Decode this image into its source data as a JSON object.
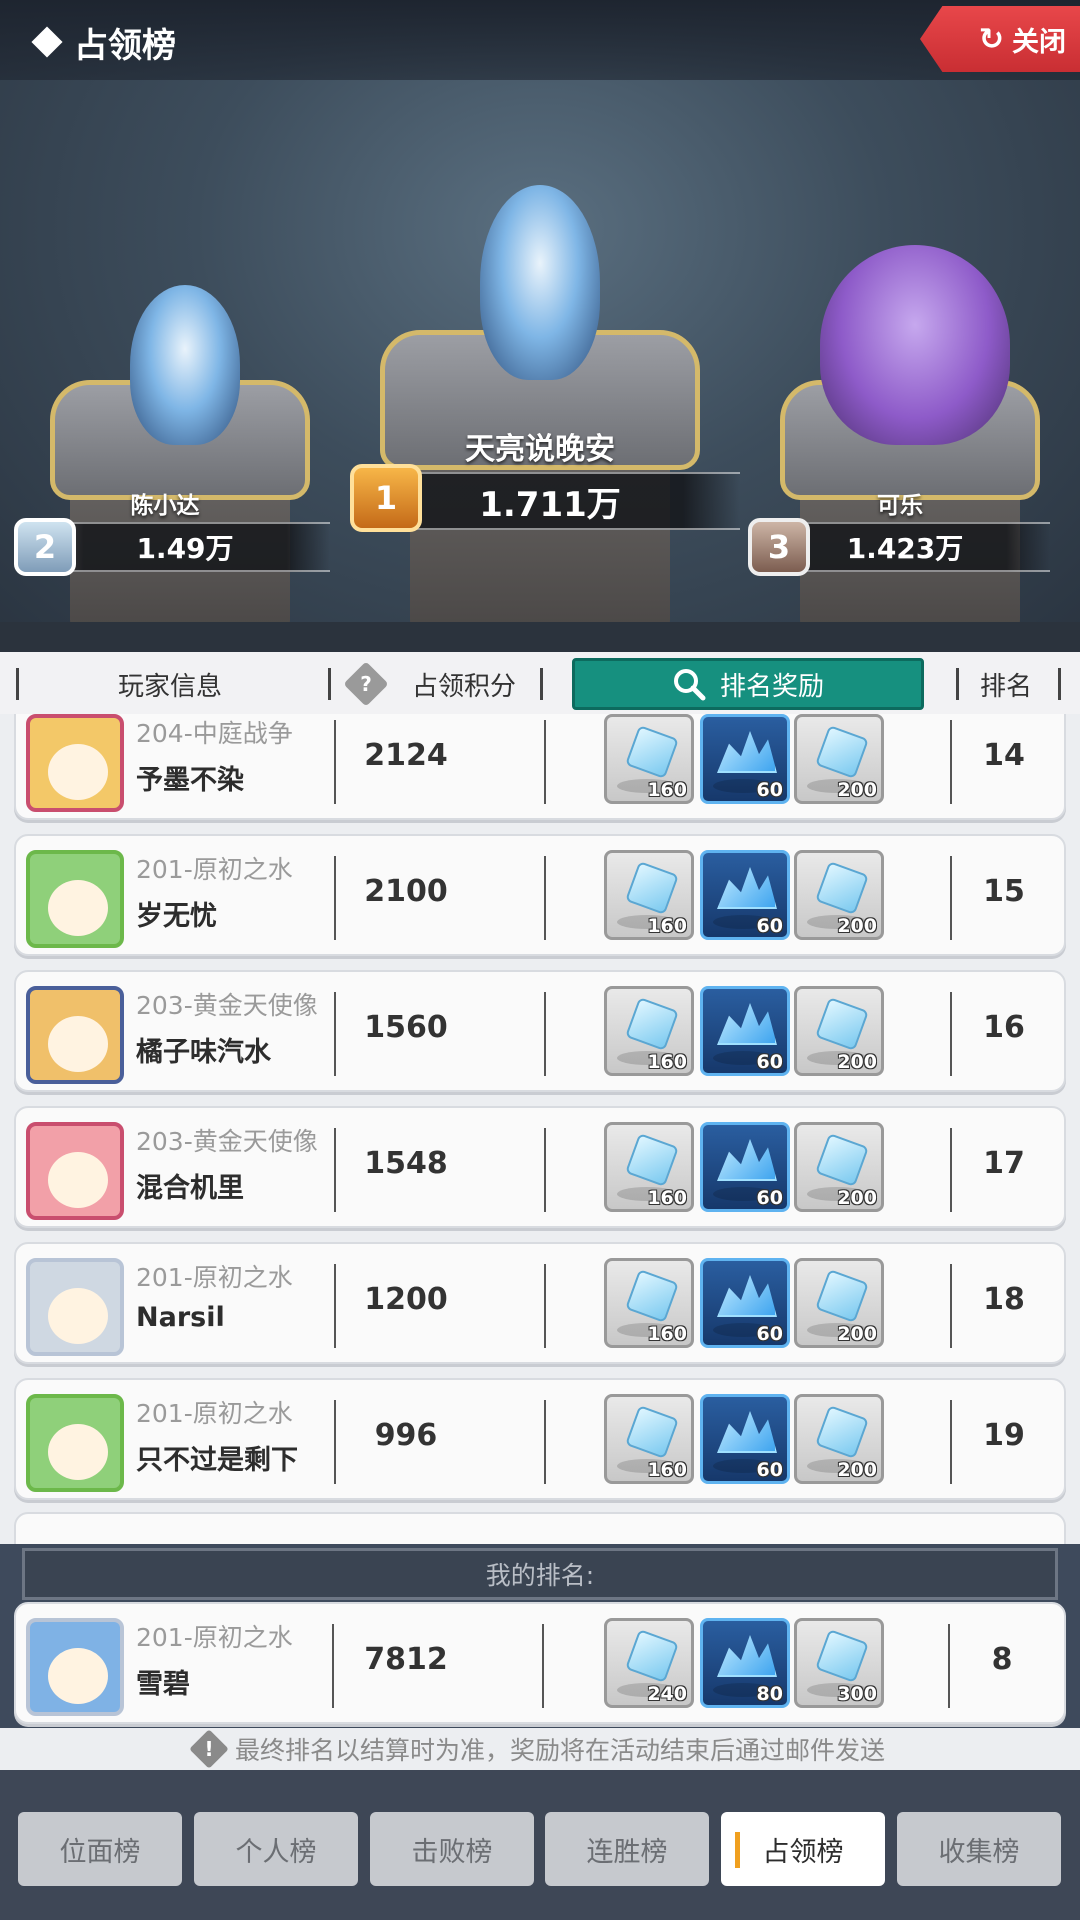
{
  "header": {
    "title": "占领榜",
    "close_label": "关闭"
  },
  "podium": {
    "first": {
      "name": "天亮说晚安",
      "score": "1.711万",
      "rank": "1"
    },
    "second": {
      "name": "陈小达",
      "score": "1.49万",
      "rank": "2"
    },
    "third": {
      "name": "可乐",
      "score": "1.423万",
      "rank": "3"
    }
  },
  "columns": {
    "player_info": "玩家信息",
    "score": "占领积分",
    "rewards": "排名奖励",
    "rank": "排名"
  },
  "rows": [
    {
      "server": "204-中庭战争",
      "name": "予墨不染",
      "score": "2124",
      "rewards": [
        "160",
        "60",
        "200"
      ],
      "rank": "14"
    },
    {
      "server": "201-原初之水",
      "name": "岁无忧",
      "score": "2100",
      "rewards": [
        "160",
        "60",
        "200"
      ],
      "rank": "15"
    },
    {
      "server": "203-黄金天使像",
      "name": "橘子味汽水",
      "score": "1560",
      "rewards": [
        "160",
        "60",
        "200"
      ],
      "rank": "16"
    },
    {
      "server": "203-黄金天使像",
      "name": "混合机里",
      "score": "1548",
      "rewards": [
        "160",
        "60",
        "200"
      ],
      "rank": "17"
    },
    {
      "server": "201-原初之水",
      "name": "Narsil",
      "score": "1200",
      "rewards": [
        "160",
        "60",
        "200"
      ],
      "rank": "18"
    },
    {
      "server": "201-原初之水",
      "name": "只不过是剩下",
      "score": "996",
      "rewards": [
        "160",
        "60",
        "200"
      ],
      "rank": "19"
    }
  ],
  "my_rank": {
    "label": "我的排名:",
    "server": "201-原初之水",
    "name": "雪碧",
    "score": "7812",
    "rewards": [
      "240",
      "80",
      "300"
    ],
    "rank": "8"
  },
  "notice": "最终排名以结算时为准，奖励将在活动结束后通过邮件发送",
  "bottom_tabs": [
    "位面榜",
    "个人榜",
    "击败榜",
    "连胜榜",
    "占领榜",
    "收集榜"
  ],
  "active_tab": "占领榜",
  "colors": {
    "accent_teal": "#16907f",
    "close_red": "#d83a3e",
    "active_tab_marker": "#f0a020"
  }
}
